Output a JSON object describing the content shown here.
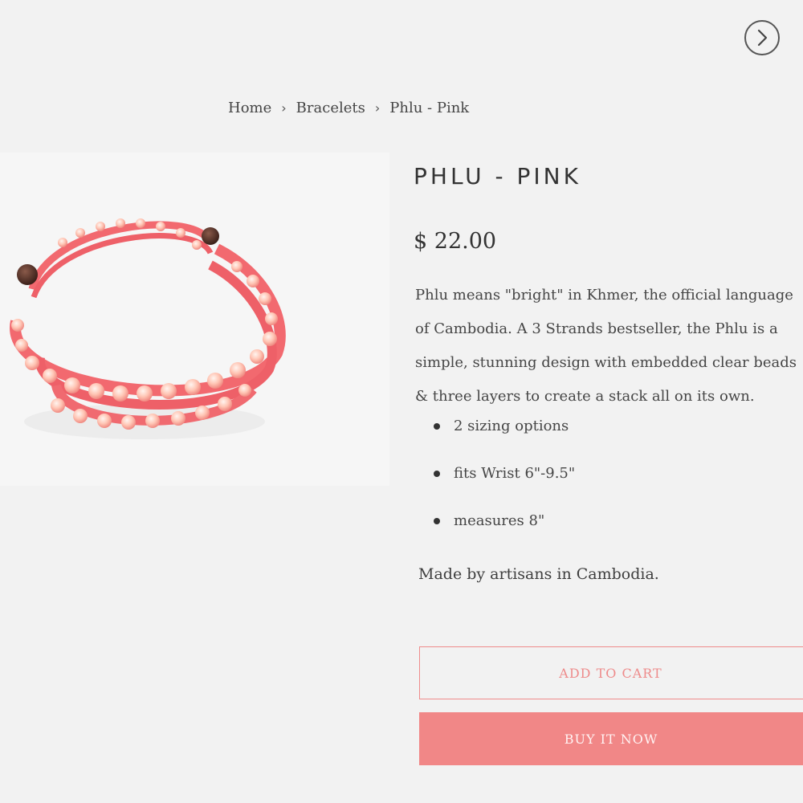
{
  "navigation": {
    "next_icon": "chevron-right-icon"
  },
  "breadcrumb": {
    "items": [
      "Home",
      "Bracelets",
      "Phlu - Pink"
    ],
    "separator_icon": "chevron-right-icon"
  },
  "product": {
    "title": "PHLU - PINK",
    "price": "$ 22.00",
    "description": "Phlu means \"bright\" in Khmer, the official language of Cambodia. A 3 Strands bestseller, the Phlu is a simple, stunning design with embedded clear beads & three layers to create a stack all on its own.",
    "features": [
      "2 sizing options",
      "fits Wrist 6\"-9.5\"",
      "measures 8\""
    ],
    "made_by": "Made by artisans in Cambodia.",
    "image": "pink beaded bracelet"
  },
  "actions": {
    "add_to_cart": "ADD TO CART",
    "buy_now": "BUY IT NOW"
  },
  "colors": {
    "accent": "#f18787",
    "bracelet": "#f2696f",
    "bead": "#ffc7b5",
    "background": "#f2f2f2"
  }
}
